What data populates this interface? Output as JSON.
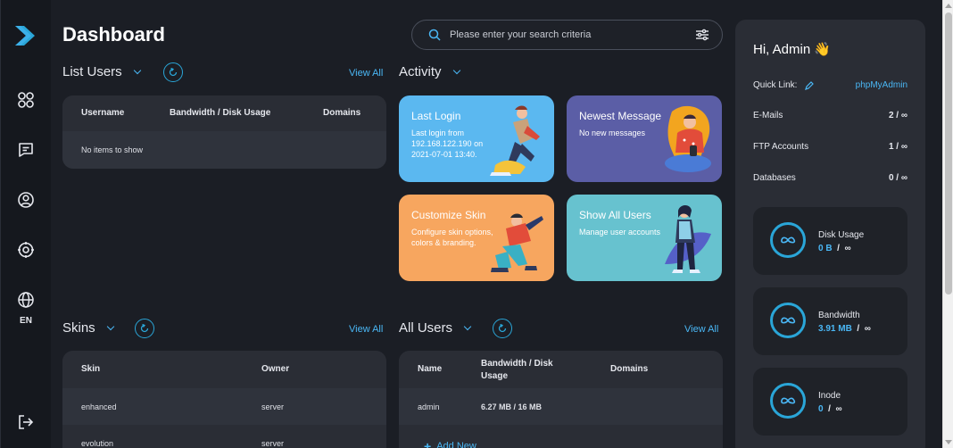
{
  "header": {
    "title": "Dashboard"
  },
  "search": {
    "placeholder": "Please enter your search criteria"
  },
  "sidebar": {
    "language": "EN"
  },
  "list_users": {
    "title": "List Users",
    "view_all": "View All",
    "columns": [
      "Username",
      "Bandwidth / Disk Usage",
      "Domains"
    ],
    "empty_text": "No items to show"
  },
  "activity": {
    "title": "Activity",
    "tiles": [
      {
        "title": "Last Login",
        "text": "Last login from 192.168.122.190 on 2021-07-01 13:40.",
        "color": "#5bb8f0"
      },
      {
        "title": "Newest Message",
        "text": "No new messages",
        "color": "#5b5ea6"
      },
      {
        "title": "Customize Skin",
        "text": "Configure skin options, colors & branding.",
        "color": "#f7a65f"
      },
      {
        "title": "Show All Users",
        "text": "Manage user accounts",
        "color": "#67c2cf"
      }
    ]
  },
  "skins": {
    "title": "Skins",
    "view_all": "View All",
    "columns": [
      "Skin",
      "Owner"
    ],
    "rows": [
      {
        "skin": "enhanced",
        "owner": "server"
      },
      {
        "skin": "evolution",
        "owner": "server"
      }
    ]
  },
  "all_users": {
    "title": "All Users",
    "view_all": "View All",
    "columns": [
      "Name",
      "Bandwidth / Disk Usage",
      "Domains"
    ],
    "rows": [
      {
        "name": "admin",
        "bandwidth": "6.27 MB / 16 MB",
        "domains": ""
      }
    ],
    "add_new": "Add New"
  },
  "panel": {
    "greeting": "Hi, Admin 👋",
    "quick_link_label": "Quick Link:",
    "quick_link_value": "phpMyAdmin",
    "items": [
      {
        "label": "E-Mails",
        "value": "2 / ∞"
      },
      {
        "label": "FTP Accounts",
        "value": "1 / ∞"
      },
      {
        "label": "Databases",
        "value": "0 / ∞"
      }
    ],
    "stats": [
      {
        "label": "Disk Usage",
        "used": "0 B",
        "limit": "∞"
      },
      {
        "label": "Bandwidth",
        "used": "3.91 MB",
        "limit": "∞"
      },
      {
        "label": "Inode",
        "used": "0",
        "limit": "∞"
      }
    ],
    "separator": "/"
  },
  "colors": {
    "accent": "#4ab7f5",
    "background": "#1b1e25",
    "card": "#2a2d35"
  }
}
